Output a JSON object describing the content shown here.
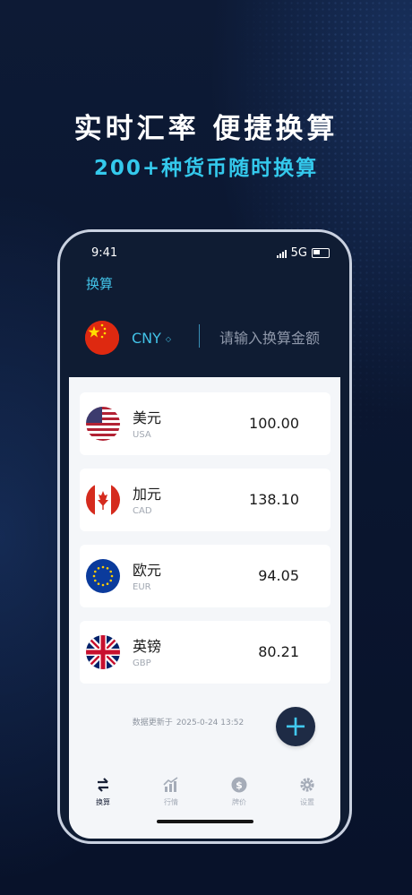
{
  "promo": {
    "headline": "实时汇率  便捷换算",
    "subline": "200+种货币随时换算"
  },
  "status_bar": {
    "time": "9:41",
    "network": "5G"
  },
  "header": {
    "tab_title": "换算"
  },
  "base_currency": {
    "code": "CNY",
    "flag_icon": "china-flag-icon"
  },
  "amount_input": {
    "placeholder": "请输入换算金额",
    "value": ""
  },
  "currencies": [
    {
      "name": "美元",
      "code": "USA",
      "value": "100.00",
      "flag_icon": "usa-flag-icon"
    },
    {
      "name": "加元",
      "code": "CAD",
      "value": "138.10",
      "flag_icon": "canada-flag-icon"
    },
    {
      "name": "欧元",
      "code": "EUR",
      "value": "94.05",
      "flag_icon": "eu-flag-icon"
    },
    {
      "name": "英镑",
      "code": "GBP",
      "value": "80.21",
      "flag_icon": "uk-flag-icon"
    }
  ],
  "update_info": {
    "label": "数据更新于",
    "timestamp": "2025-0-24 13:52"
  },
  "add_button": {
    "label": "+"
  },
  "bottom_nav": [
    {
      "label": "换算",
      "icon": "exchange-arrows-icon",
      "active": true
    },
    {
      "label": "行情",
      "icon": "trend-chart-icon",
      "active": false
    },
    {
      "label": "牌价",
      "icon": "dollar-coin-icon",
      "active": false
    },
    {
      "label": "设置",
      "icon": "gear-icon",
      "active": false
    }
  ],
  "colors": {
    "accent": "#42c3e8",
    "background": "#0b1630",
    "card": "#ffffff"
  }
}
